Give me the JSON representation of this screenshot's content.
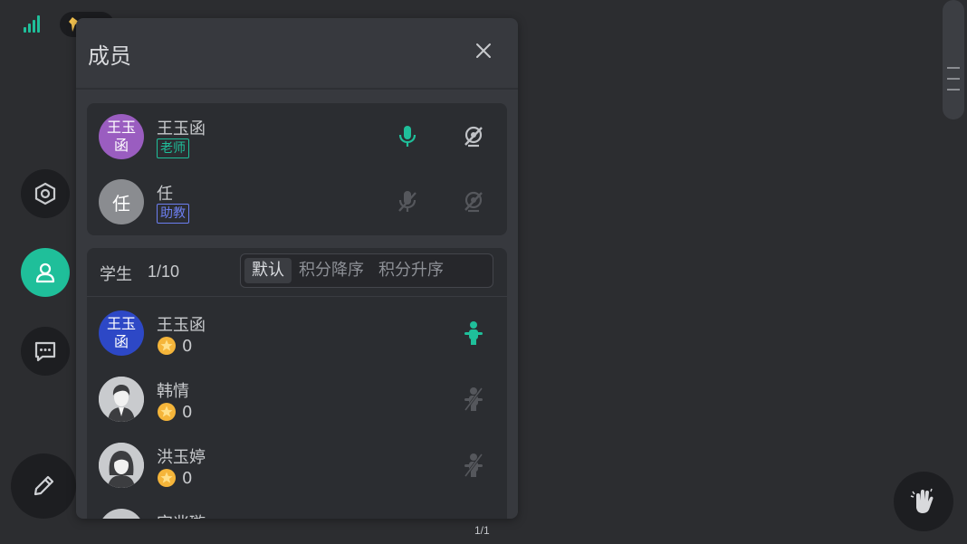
{
  "panel": {
    "title": "成员"
  },
  "teachers": [
    {
      "avatar_text": "王玉函",
      "name": "王玉函",
      "role": "老师",
      "mic_on": true,
      "camera_on": false
    },
    {
      "avatar_text": "任",
      "name": "任",
      "role": "助教",
      "mic_on": false,
      "camera_on": false
    }
  ],
  "students_header": {
    "label": "学生",
    "count": "1/10",
    "sort_options": [
      "默认",
      "积分降序",
      "积分升序"
    ],
    "active_sort": "默认"
  },
  "students": [
    {
      "avatar_text": "王玉函",
      "name": "王玉函",
      "score": "0"
    },
    {
      "name": "韩情",
      "score": "0"
    },
    {
      "name": "洪玉婷",
      "score": "0"
    },
    {
      "name": "宋兆璇"
    }
  ],
  "page_indicator": "1/1",
  "colors": {
    "accent": "#1fbf9a",
    "background": "#2c2d30",
    "panel": "#37393e",
    "card": "#2b2d31",
    "assistant_tag": "#6c7ef0",
    "star": "#f5b53a"
  },
  "icons": [
    "signal-icon",
    "settings-icon",
    "members-icon",
    "chat-icon",
    "pen-icon",
    "close-icon",
    "microphone-icon",
    "camera-off-icon",
    "stage-icon",
    "raise-hand-icon",
    "star-icon"
  ]
}
